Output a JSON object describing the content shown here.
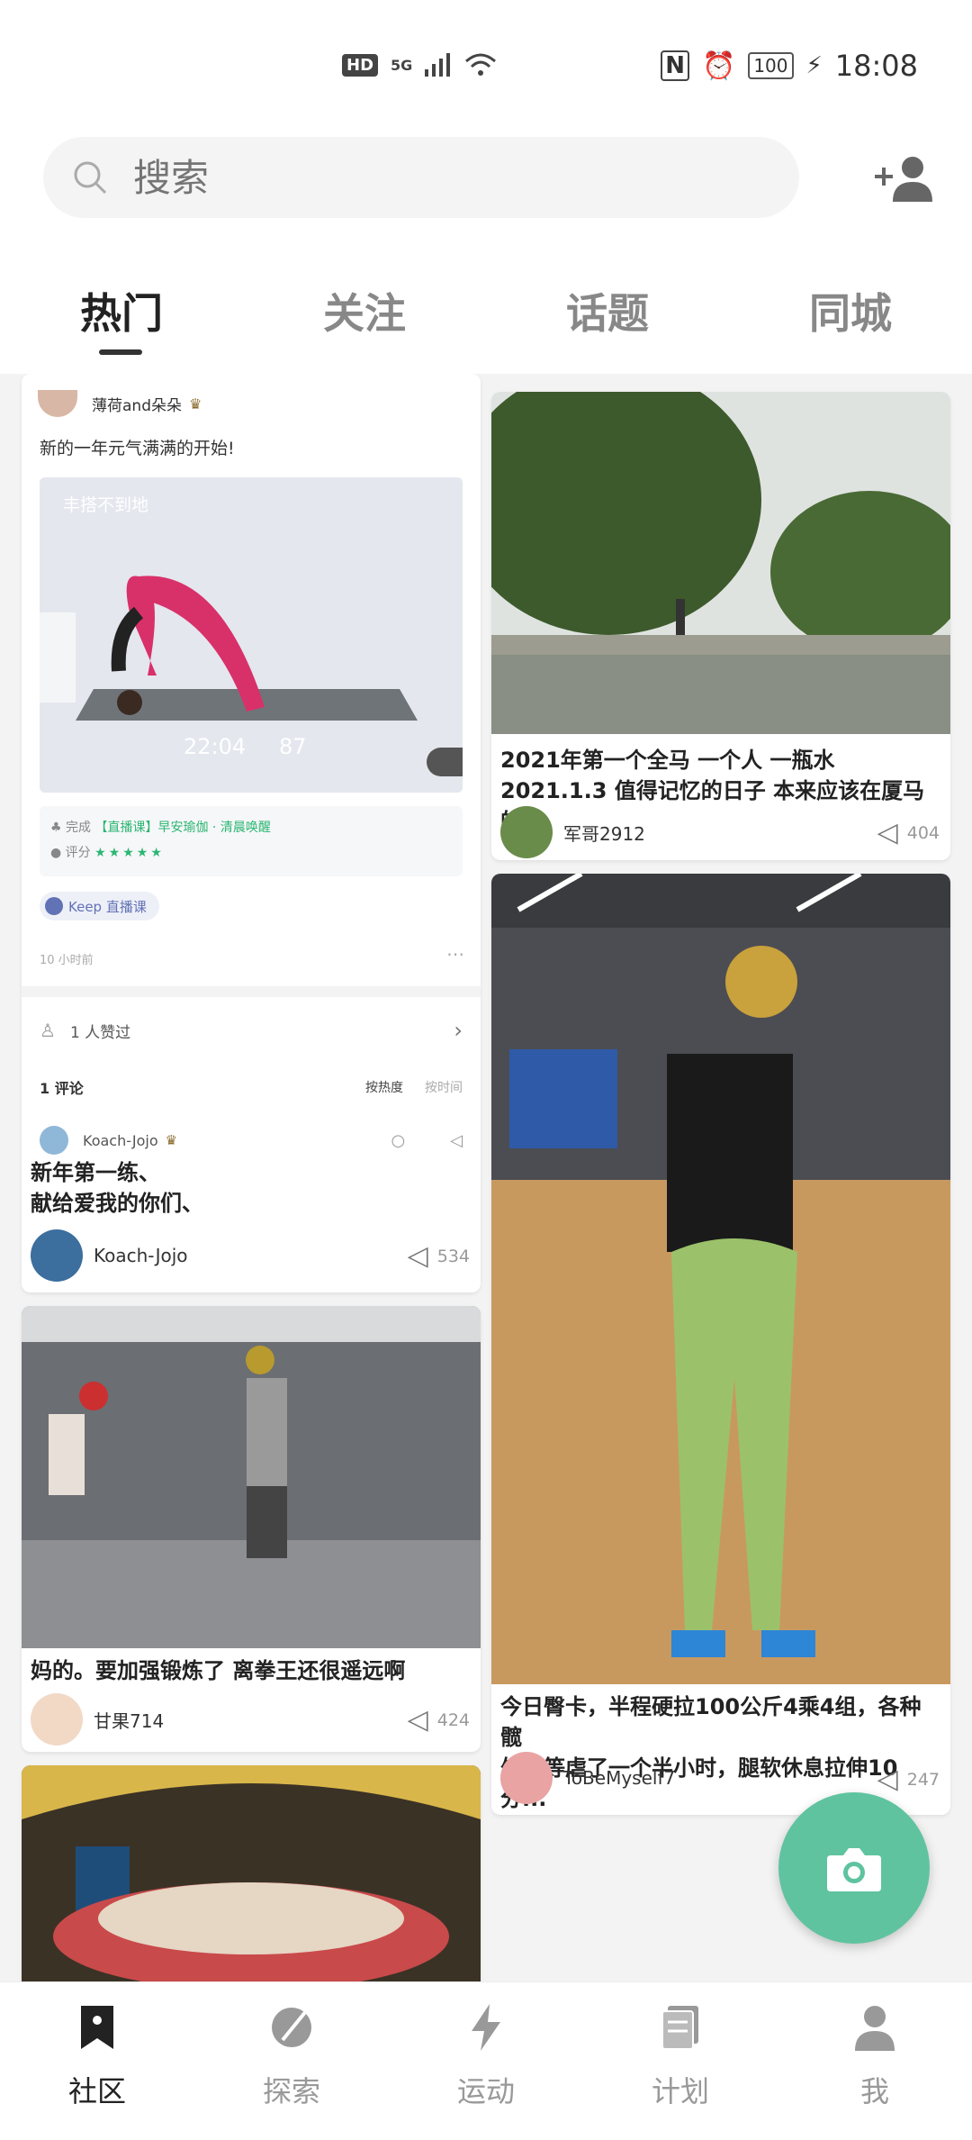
{
  "status": {
    "hd": "HD",
    "network": "5G",
    "battery": "100",
    "time": "18:08"
  },
  "search": {
    "placeholder": "搜索"
  },
  "tabs": [
    {
      "label": "热门",
      "active": true
    },
    {
      "label": "关注",
      "active": false
    },
    {
      "label": "话题",
      "active": false
    },
    {
      "label": "同城",
      "active": false
    }
  ],
  "feed": {
    "card1": {
      "author": "薄荷and朵朵",
      "text": "新的一年元气满满的开始!",
      "video_overlay": "丰搭不到地",
      "time_value": "22:04",
      "kcal_value": "87",
      "complete_prefix": "完成",
      "complete_course": "【直播课】早安瑜伽 · 清晨唤醒",
      "rating_label": "评分",
      "stars": "★★★★★",
      "tag": "Keep 直播课",
      "posted": "10 小时前",
      "liked_by": "1 人赞过",
      "comments_count": "1 评论",
      "sort_hot": "按热度",
      "sort_time": "按时间",
      "comment_author": "Koach-Jojo",
      "comment_text_1": "新年第一练、",
      "comment_text_2": "献给爱我的你们、",
      "footer_user": "Koach-Jojo",
      "likes": "534"
    },
    "card2": {
      "title_1": "2021年第一个全马 一个人 一瓶水",
      "title_2": "2021.1.3 值得记忆的日子 本来应该在厦马的...",
      "user": "军哥2912",
      "likes": "404"
    },
    "card3": {
      "title": "妈的。要加强锻炼了 离拳王还很遥远啊",
      "user": "甘果714",
      "likes": "424"
    },
    "card4": {
      "title_1": "今日臀卡，半程硬拉100公斤4乘4组，各种髋",
      "title_2": "外展等虐了一个半小时，腿软休息拉伸10分...",
      "user": "ToBeMyself7",
      "likes": "247"
    }
  },
  "bottom_nav": [
    {
      "label": "社区",
      "active": true
    },
    {
      "label": "探索",
      "active": false
    },
    {
      "label": "运动",
      "active": false
    },
    {
      "label": "计划",
      "active": false
    },
    {
      "label": "我",
      "active": false
    }
  ],
  "colors": {
    "accent": "#5fc3a0",
    "course_green": "#2bb673"
  }
}
